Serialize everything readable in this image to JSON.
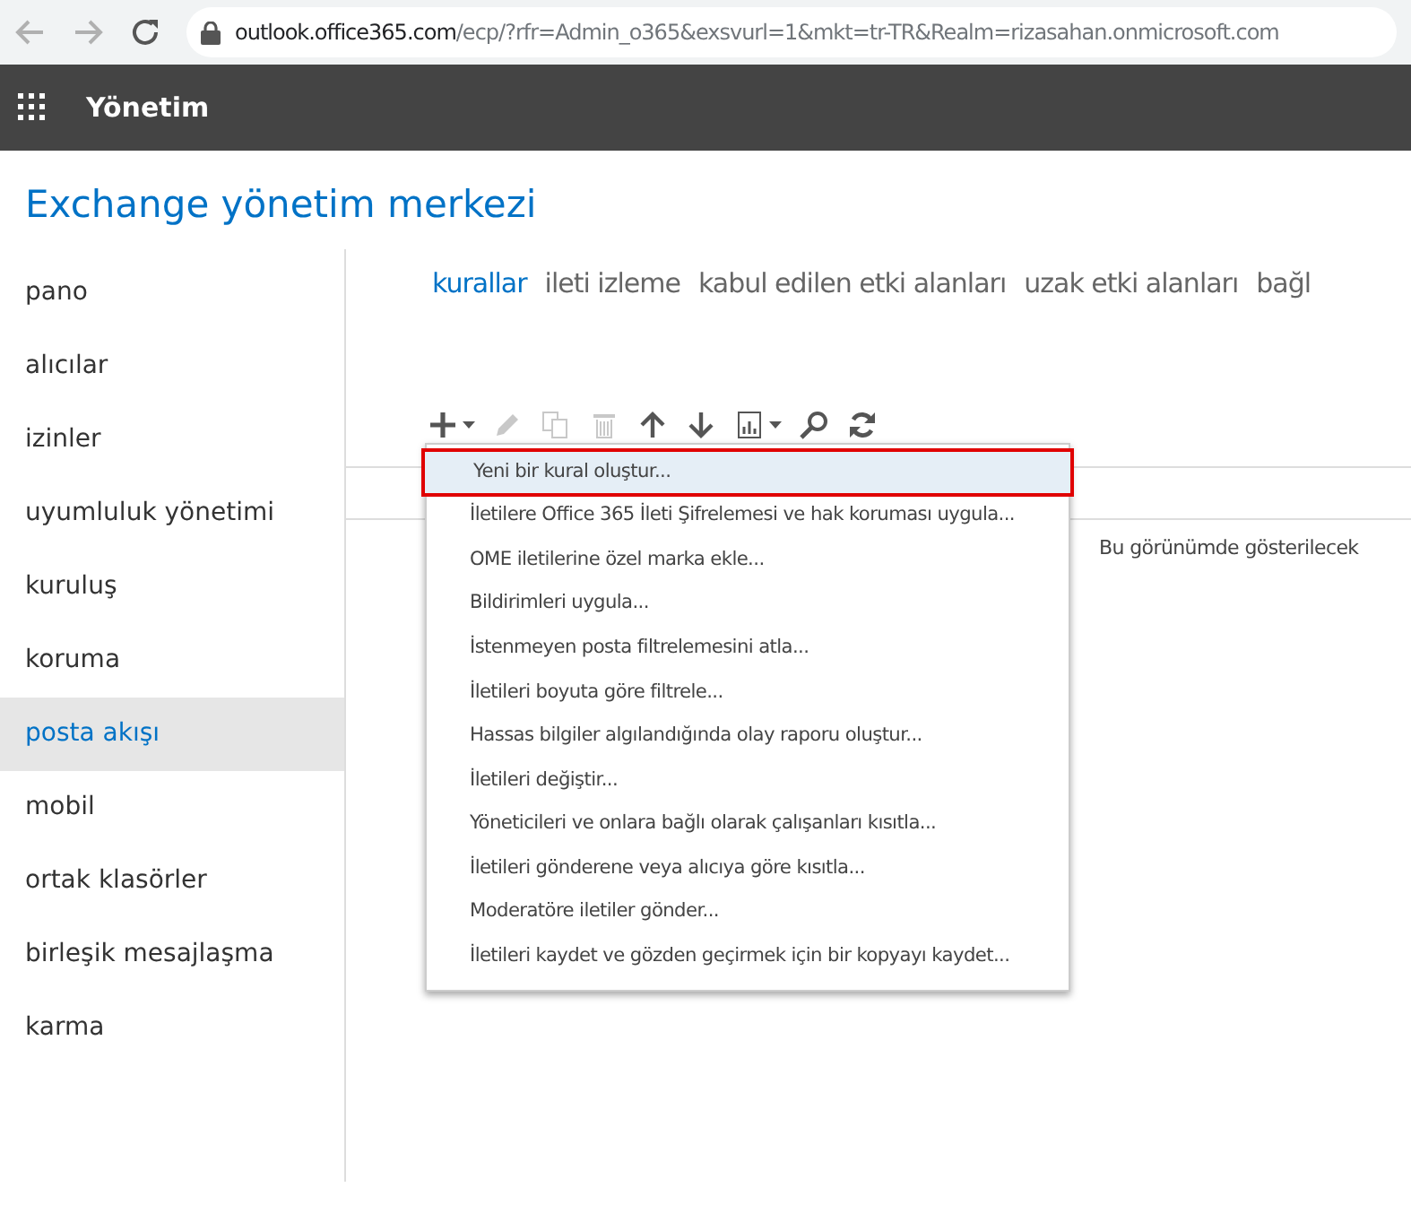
{
  "browser": {
    "url_host": "outlook.office365.com",
    "url_path": "/ecp/?rfr=Admin_o365&exsvurl=1&mkt=tr-TR&Realm=rizasahan.onmicrosoft.com"
  },
  "header": {
    "title": "Yönetim"
  },
  "page_title": "Exchange yönetim merkezi",
  "sidebar": {
    "items": [
      {
        "label": "pano",
        "selected": false
      },
      {
        "label": "alıcılar",
        "selected": false
      },
      {
        "label": "izinler",
        "selected": false
      },
      {
        "label": "uyumluluk yönetimi",
        "selected": false
      },
      {
        "label": "kuruluş",
        "selected": false
      },
      {
        "label": "koruma",
        "selected": false
      },
      {
        "label": "posta akışı",
        "selected": true
      },
      {
        "label": "mobil",
        "selected": false
      },
      {
        "label": "ortak klasörler",
        "selected": false
      },
      {
        "label": "birleşik mesajlaşma",
        "selected": false
      },
      {
        "label": "karma",
        "selected": false
      }
    ]
  },
  "tabs": [
    {
      "label": "kurallar",
      "selected": true
    },
    {
      "label": "ileti izleme",
      "selected": false
    },
    {
      "label": "kabul edilen etki alanları",
      "selected": false
    },
    {
      "label": "uzak etki alanları",
      "selected": false
    },
    {
      "label": "bağl",
      "selected": false
    }
  ],
  "toolbar": [
    {
      "kind": "add",
      "disabled": false
    },
    {
      "kind": "edit",
      "disabled": true
    },
    {
      "kind": "copy",
      "disabled": true
    },
    {
      "kind": "delete",
      "disabled": true
    },
    {
      "kind": "up",
      "disabled": false
    },
    {
      "kind": "down",
      "disabled": false
    },
    {
      "kind": "report",
      "disabled": false
    },
    {
      "kind": "search",
      "disabled": false
    },
    {
      "kind": "refresh",
      "disabled": false
    }
  ],
  "empty_message": "Bu görünümde gösterilecek",
  "menu": {
    "items": [
      {
        "label": "Yeni bir kural oluştur...",
        "selected": true
      },
      {
        "label": "İletilere Office 365 İleti Şifrelemesi ve hak koruması uygula...",
        "selected": false
      },
      {
        "label": "OME iletilerine özel marka ekle...",
        "selected": false
      },
      {
        "label": "Bildirimleri uygula...",
        "selected": false
      },
      {
        "label": "İstenmeyen posta filtrelemesini atla...",
        "selected": false
      },
      {
        "label": "İletileri boyuta göre filtrele...",
        "selected": false
      },
      {
        "label": "Hassas bilgiler algılandığında olay raporu oluştur...",
        "selected": false
      },
      {
        "label": "İletileri değiştir...",
        "selected": false
      },
      {
        "label": "Yöneticileri ve onlara bağlı olarak çalışanları kısıtla...",
        "selected": false
      },
      {
        "label": "İletileri gönderene veya alıcıya göre kısıtla...",
        "selected": false
      },
      {
        "label": "Moderatöre iletiler gönder...",
        "selected": false
      },
      {
        "label": "İletileri kaydet ve gözden geçirmek için bir kopyayı kaydet...",
        "selected": false
      }
    ]
  }
}
